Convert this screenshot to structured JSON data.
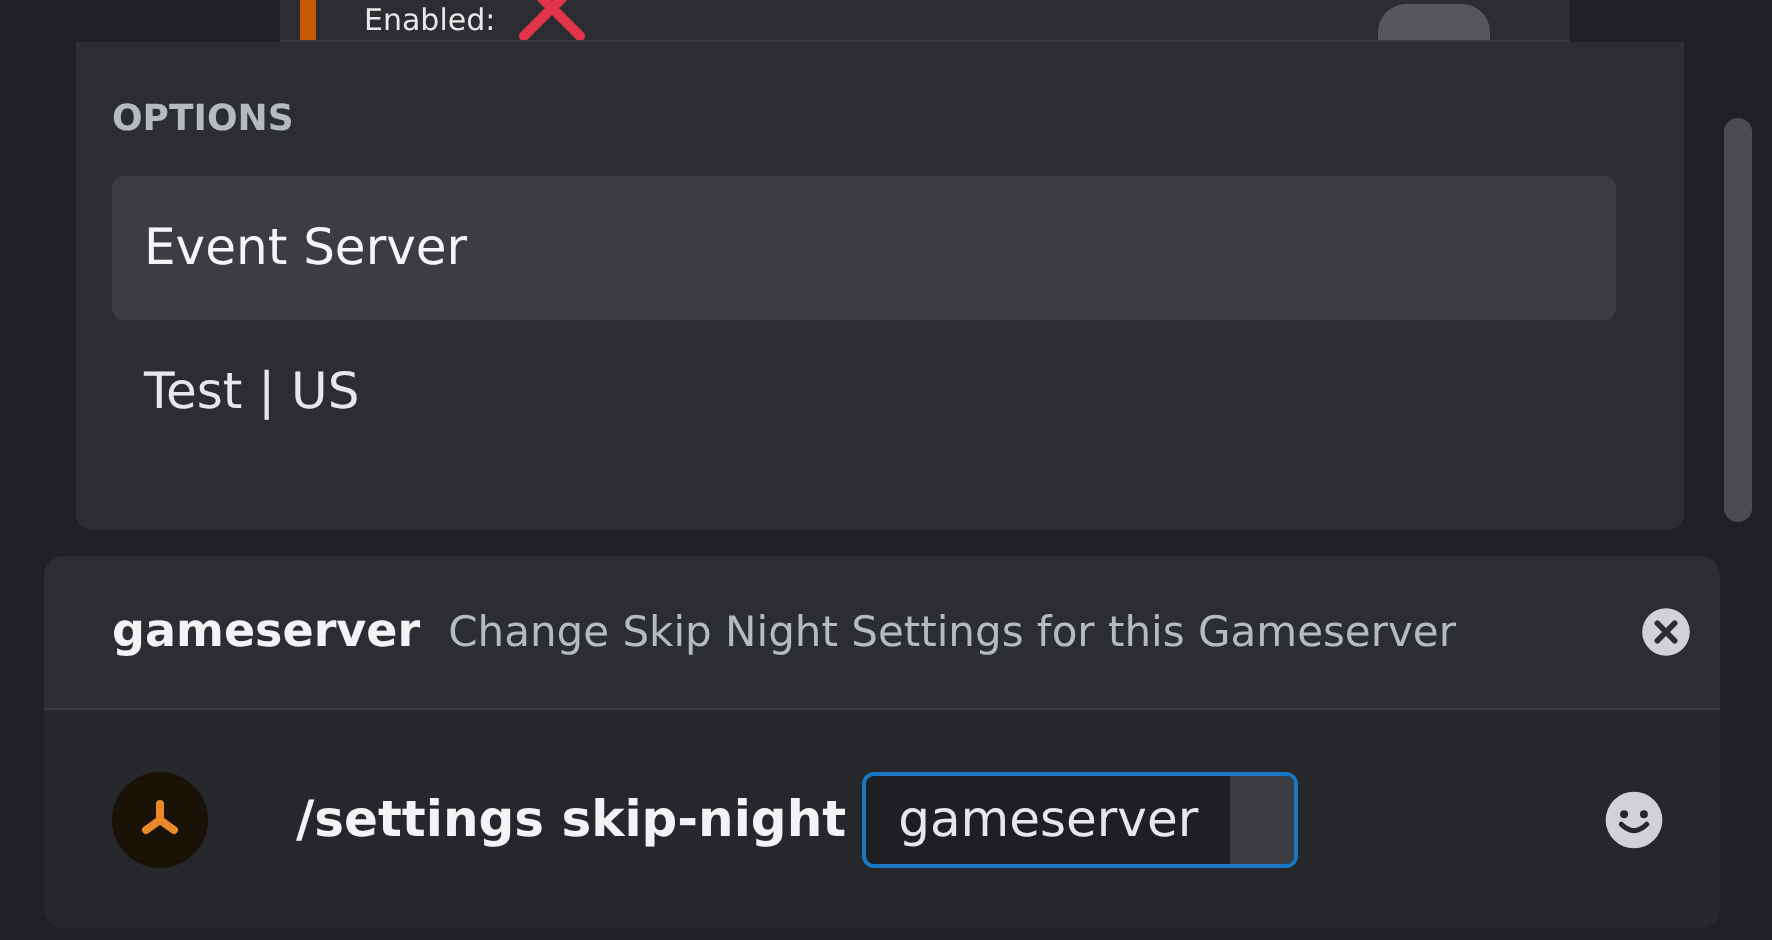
{
  "message": {
    "text": "Enabled:"
  },
  "options": {
    "heading": "OPTIONS",
    "items": [
      {
        "label": "Event Server",
        "selected": true
      },
      {
        "label": "Test | US",
        "selected": false
      }
    ]
  },
  "command_hint": {
    "name": "gameserver",
    "description": "Change Skip Night Settings for this Gameserver"
  },
  "composer": {
    "command": "/settings skip-night",
    "option": {
      "value": "gameserver",
      "focused": true
    }
  }
}
